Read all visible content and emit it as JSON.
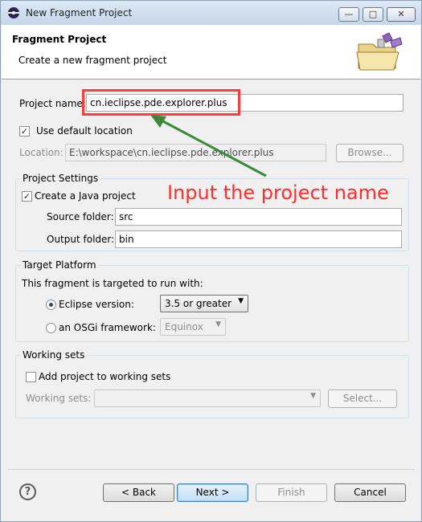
{
  "window": {
    "title": "New Fragment Project"
  },
  "header": {
    "title": "Fragment Project",
    "subtitle": "Create a new fragment project"
  },
  "project": {
    "name_label": "Project name:",
    "name_value": "cn.ieclipse.pde.explorer.plus",
    "use_default_location_label": "Use default location",
    "use_default_location_checked": true,
    "location_label": "Location:",
    "location_value": "E:\\workspace\\cn.ieclipse.pde.explorer.plus",
    "browse_label": "Browse..."
  },
  "project_settings": {
    "group_label": "Project Settings",
    "create_java_label": "Create a Java project",
    "create_java_checked": true,
    "source_folder_label": "Source folder:",
    "source_folder_value": "src",
    "output_folder_label": "Output folder:",
    "output_folder_value": "bin"
  },
  "target_platform": {
    "group_label": "Target Platform",
    "description": "This fragment is targeted to run with:",
    "eclipse_version_label": "Eclipse version:",
    "eclipse_version_selected": true,
    "eclipse_version_value": "3.5 or greater",
    "osgi_label": "an OSGi framework:",
    "osgi_value": "Equinox"
  },
  "working_sets": {
    "group_label": "Working sets",
    "add_label": "Add project to working sets",
    "add_checked": false,
    "sets_label": "Working sets:",
    "sets_value": "",
    "select_label": "Select..."
  },
  "annotation": {
    "text": "Input the project name",
    "color": "#ff2e2e"
  },
  "footer": {
    "back_label": "< Back",
    "next_label": "Next >",
    "finish_label": "Finish",
    "cancel_label": "Cancel"
  }
}
